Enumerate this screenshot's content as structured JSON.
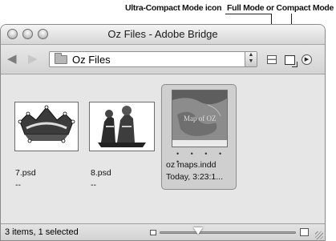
{
  "callouts": {
    "ultra_compact": "Ultra-Compact Mode icon",
    "full_compact": "Full Mode or Compact Mode icon"
  },
  "window": {
    "title": "Oz Files - Adobe Bridge"
  },
  "toolbar": {
    "path_label": "Oz Files",
    "back_icon": "back-arrow-icon",
    "forward_icon": "forward-arrow-icon",
    "folder_icon": "folder-icon"
  },
  "files": [
    {
      "name": "7.psd",
      "date": "--",
      "selected": false
    },
    {
      "name": "8.psd",
      "date": "--",
      "selected": false
    },
    {
      "name": "oz maps.indd",
      "date": "Today, 3:23:1...",
      "selected": true,
      "rating_dots": "• • • • •"
    }
  ],
  "status": {
    "text": "3 items, 1 selected"
  },
  "colors": {
    "window_bg": "#e6e6e6",
    "selection_bg": "#cfcfcf"
  }
}
